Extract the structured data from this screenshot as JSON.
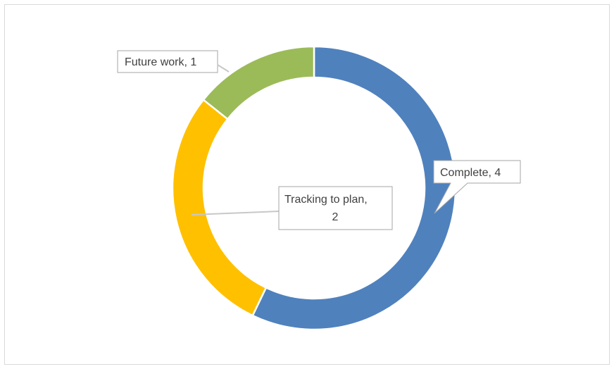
{
  "chart_data": {
    "type": "pie",
    "subtype": "doughnut",
    "title": "",
    "categories": [
      "Complete",
      "Tracking to plan",
      "Future work"
    ],
    "values": [
      4,
      2,
      1
    ],
    "colors": [
      "#4f81bd",
      "#ffc000",
      "#9bbb59"
    ],
    "data_labels": [
      "Complete, 4",
      "Tracking to plan, 2",
      "Future work, 1"
    ],
    "legend": "none"
  }
}
